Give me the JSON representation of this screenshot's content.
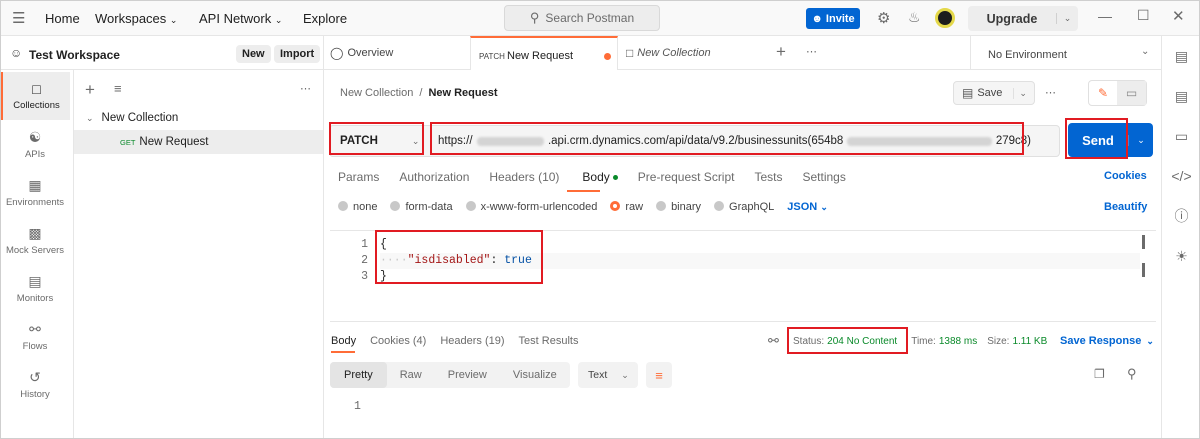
{
  "topbar": {
    "home": "Home",
    "workspaces": "Workspaces",
    "api_network": "API Network",
    "explore": "Explore",
    "search_placeholder": "Search Postman",
    "invite": "Invite",
    "upgrade": "Upgrade"
  },
  "workspace": {
    "name": "Test Workspace",
    "new_label": "New",
    "import_label": "Import"
  },
  "tabs": {
    "overview": "Overview",
    "request_method": "PATCH",
    "request_name": "New Request",
    "collection": "New Collection",
    "environment": "No Environment"
  },
  "sidebar": {
    "items": [
      {
        "label": "Collections",
        "icon": "collections-icon"
      },
      {
        "label": "APIs",
        "icon": "apis-icon"
      },
      {
        "label": "Environments",
        "icon": "environments-icon"
      },
      {
        "label": "Mock Servers",
        "icon": "mock-servers-icon"
      },
      {
        "label": "Monitors",
        "icon": "monitors-icon"
      },
      {
        "label": "Flows",
        "icon": "flows-icon"
      },
      {
        "label": "History",
        "icon": "history-icon"
      }
    ]
  },
  "tree": {
    "collection": "New Collection",
    "request_method": "GET",
    "request_name": "New Request"
  },
  "request": {
    "breadcrumb_collection": "New Collection",
    "breadcrumb_sep": "/",
    "breadcrumb_request": "New Request",
    "save_label": "Save",
    "method": "PATCH",
    "url_prefix": "https://",
    "url_middle": ".api.crm",
    "url_path": ".dynamics.com/api/data/v9.2/businessunits(654b8",
    "url_suffix": "279c8)",
    "send_label": "Send",
    "tabs": [
      "Params",
      "Authorization",
      "Headers (10)",
      "Body",
      "Pre-request Script",
      "Tests",
      "Settings"
    ],
    "cookies_label": "Cookies",
    "body_modes": [
      "none",
      "form-data",
      "x-www-form-urlencoded",
      "raw",
      "binary",
      "GraphQL"
    ],
    "body_format": "JSON",
    "beautify_label": "Beautify",
    "body_lines": [
      {
        "num": "1",
        "text": "{"
      },
      {
        "num": "2",
        "key": "\"isdisabled\"",
        "colon": ":",
        "value": "true"
      },
      {
        "num": "3",
        "text": "}"
      }
    ]
  },
  "response": {
    "tabs": [
      "Body",
      "Cookies (4)",
      "Headers (19)",
      "Test Results"
    ],
    "status_label": "Status:",
    "status_value": "204 No Content",
    "time_label": "Time:",
    "time_value": "1388 ms",
    "size_label": "Size:",
    "size_value": "1.11 KB",
    "save_response": "Save Response",
    "view_modes": [
      "Pretty",
      "Raw",
      "Preview",
      "Visualize"
    ],
    "text_format": "Text",
    "line1": "1"
  },
  "colors": {
    "accent_orange": "#ff6c37",
    "send_blue": "#0265d2",
    "status_green": "#0a8a2a",
    "annotation_red": "#e11b22"
  }
}
